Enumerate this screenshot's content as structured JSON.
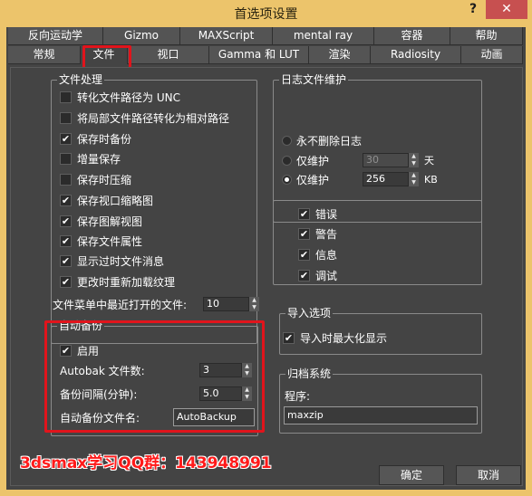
{
  "window": {
    "title": "首选项设置",
    "help": "?",
    "close": "✕"
  },
  "tabs": {
    "row1": [
      "反向运动学",
      "Gizmo",
      "MAXScript",
      "mental ray",
      "容器",
      "帮助"
    ],
    "row2": [
      "常规",
      "文件",
      "视口",
      "Gamma 和 LUT",
      "渲染",
      "Radiosity",
      "动画"
    ],
    "active": "文件"
  },
  "file_handling": {
    "title": "文件处理",
    "options": [
      {
        "label": "转化文件路径为 UNC",
        "checked": false
      },
      {
        "label": "将局部文件路径转化为相对路径",
        "checked": false
      },
      {
        "label": "保存时备份",
        "checked": true
      },
      {
        "label": "增量保存",
        "checked": false
      },
      {
        "label": "保存时压缩",
        "checked": false
      },
      {
        "label": "保存视口缩略图",
        "checked": true
      },
      {
        "label": "保存图解视图",
        "checked": true
      },
      {
        "label": "保存文件属性",
        "checked": true
      },
      {
        "label": "显示过时文件消息",
        "checked": true
      },
      {
        "label": "更改时重新加载纹理",
        "checked": true
      }
    ],
    "recent_label": "文件菜单中最近打开的文件:",
    "recent_value": "10"
  },
  "autobackup": {
    "title": "自动备份",
    "enable_label": "启用",
    "enabled": true,
    "count_label": "Autobak 文件数:",
    "count_value": "3",
    "interval_label": "备份间隔(分钟):",
    "interval_value": "5.0",
    "name_label": "自动备份文件名:",
    "name_value": "AutoBackup"
  },
  "log": {
    "title": "日志文件维护",
    "radios": [
      {
        "label": "永不删除日志",
        "selected": false
      },
      {
        "label": "仅维护",
        "value": "30",
        "unit": "天",
        "selected": false
      },
      {
        "label": "仅维护",
        "value": "256",
        "unit": "KB",
        "selected": true
      }
    ],
    "levels": [
      {
        "label": "错误",
        "checked": true
      },
      {
        "label": "警告",
        "checked": true
      },
      {
        "label": "信息",
        "checked": true
      },
      {
        "label": "调试",
        "checked": true
      }
    ]
  },
  "import": {
    "title": "导入选项",
    "maximize_label": "导入时最大化显示",
    "maximize": true
  },
  "archive": {
    "title": "归档系统",
    "program_label": "程序:",
    "program_value": "maxzip"
  },
  "buttons": {
    "ok": "确定",
    "cancel": "取消"
  },
  "watermark": "3dsmax学习QQ群：143948991",
  "colors": {
    "highlight": "#e1141c",
    "titlebar": "#ecc46b",
    "close": "#c75050",
    "dialog_bg": "#444444"
  }
}
